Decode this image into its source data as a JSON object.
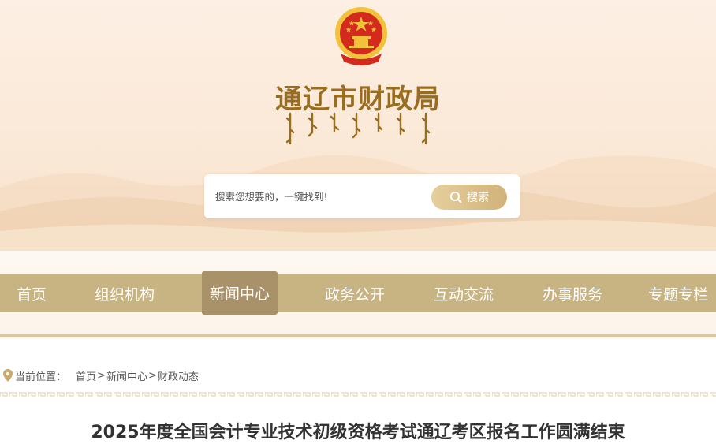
{
  "header": {
    "site_title": "通辽市财政局",
    "emblem_icon": "national-emblem-icon",
    "mongolian_script": "mongolian-title-script"
  },
  "search": {
    "placeholder": "搜索您想要的，一键找到!",
    "button_label": "搜索",
    "button_icon": "search-icon"
  },
  "nav": {
    "items": [
      {
        "label": "首页"
      },
      {
        "label": "组织机构"
      },
      {
        "label": "新闻中心",
        "active": true
      },
      {
        "label": "政务公开"
      },
      {
        "label": "互动交流"
      },
      {
        "label": "办事服务"
      },
      {
        "label": "专题专栏"
      }
    ]
  },
  "breadcrumb": {
    "prefix": "当前位置：",
    "items": [
      "首页",
      "新闻中心",
      "财政动态"
    ],
    "separator": ">",
    "icon": "location-pin-icon"
  },
  "article": {
    "title": "2025年度全国会计专业技术初级资格考试通辽考区报名工作圆满结束"
  },
  "colors": {
    "nav_bg": "#c8b383",
    "nav_active": "#a9916a",
    "title_gold": "#9a6c1f",
    "emblem_red": "#d42a1e",
    "emblem_gold": "#f2c23a"
  }
}
